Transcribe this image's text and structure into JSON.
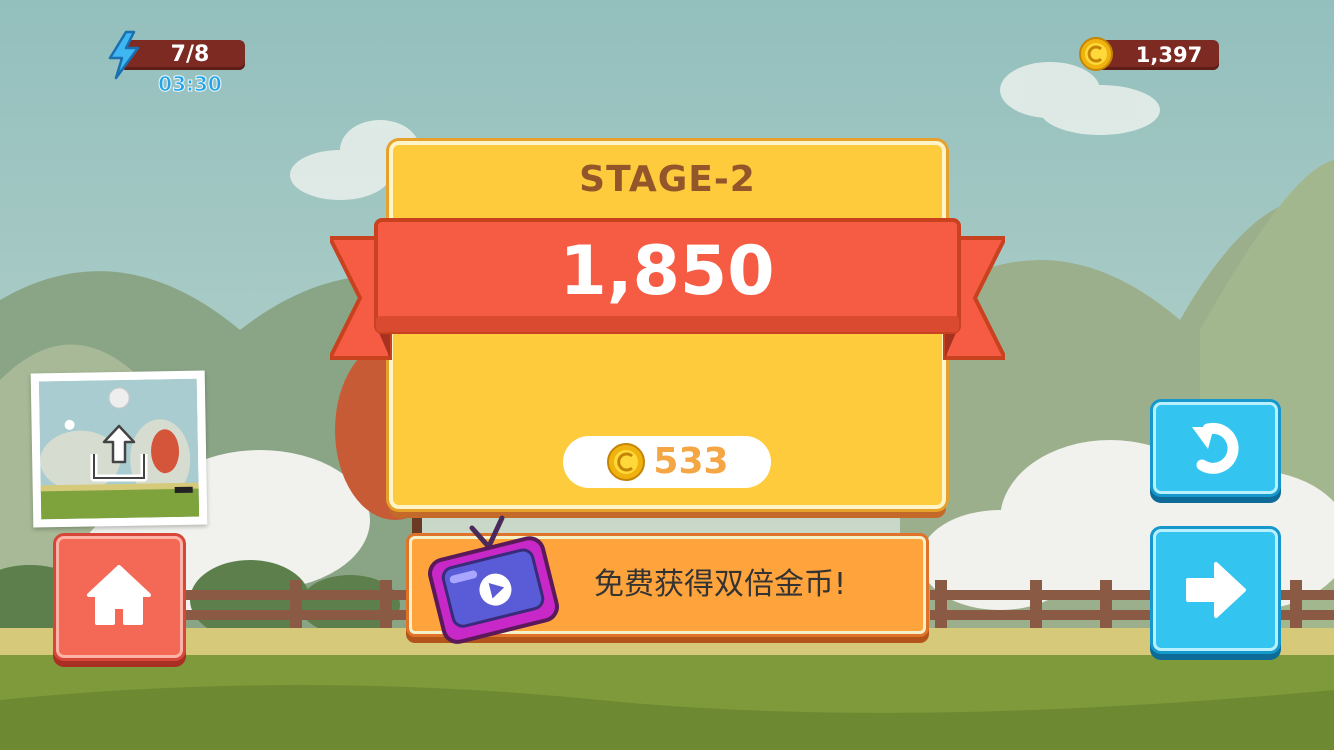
{
  "hud": {
    "energy": "7/8",
    "energy_timer": "03:30",
    "coins": "1,397"
  },
  "result": {
    "stage_title": "STAGE-2",
    "score": "1,850",
    "coin_reward": "533"
  },
  "actions": {
    "double_coins_label": "免费获得双倍金币!"
  },
  "icons": {
    "energy": "lightning-bolt",
    "coin": "gold-coin",
    "tv": "video-ad-tv",
    "share": "share-upload",
    "home": "house",
    "retry": "undo-arrow",
    "next": "right-arrow"
  },
  "colors": {
    "panel": "#fecb3d",
    "ribbon": "#f65c44",
    "home_button": "#f46856",
    "blue_button": "#33c5f0",
    "double_button": "#ffa43c",
    "hud_bar": "#7c2a22"
  }
}
